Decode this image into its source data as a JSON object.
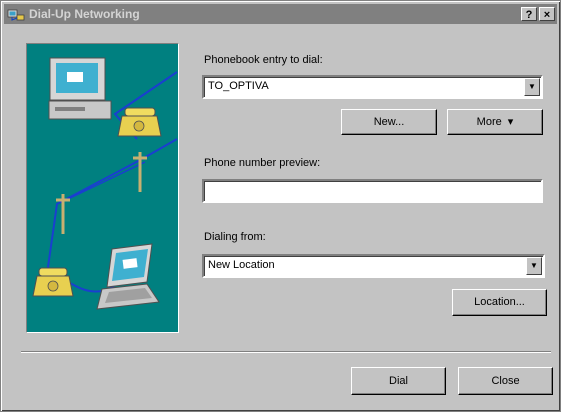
{
  "window": {
    "title": "Dial-Up Networking",
    "help_label": "?",
    "close_label": "×"
  },
  "phonebook": {
    "label": "Phonebook entry to dial:",
    "value": "TO_OPTIVA"
  },
  "buttons": {
    "new": "New...",
    "more": "More",
    "location": "Location...",
    "dial": "Dial",
    "close": "Close"
  },
  "phone_preview": {
    "label": "Phone number preview:",
    "value": ""
  },
  "dialing_from": {
    "label": "Dialing from:",
    "value": "New Location"
  },
  "icons": {
    "title": "dial-up-networking-icon",
    "dropdown": "triangle-down",
    "more_arrow": "▾"
  }
}
